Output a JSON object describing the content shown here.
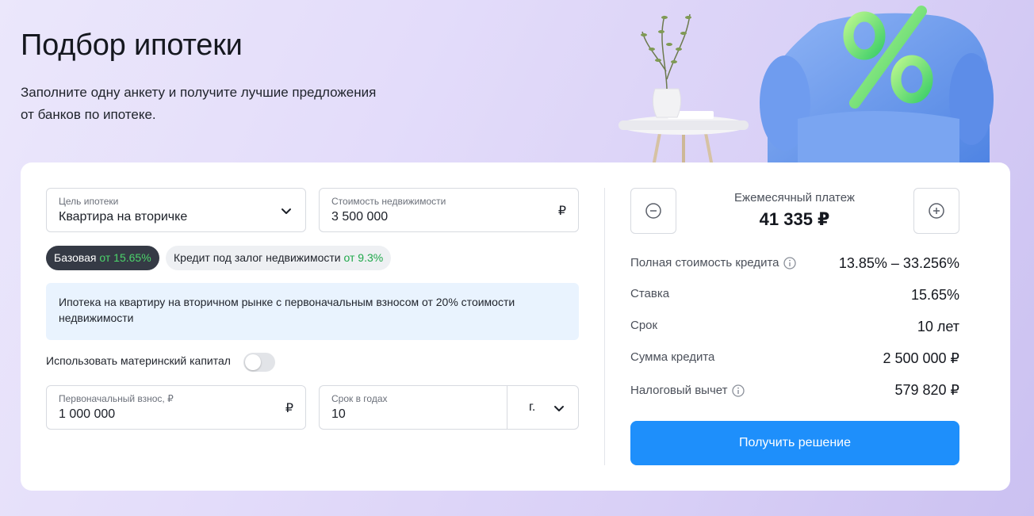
{
  "header": {
    "title": "Подбор ипотеки",
    "subtitle_line1": "Заполните одну анкету и получите лучшие предложения",
    "subtitle_line2": "от банков по ипотеке."
  },
  "form": {
    "purpose": {
      "label": "Цель ипотеки",
      "value": "Квартира на вторичке"
    },
    "price": {
      "label": "Стоимость недвижимости",
      "value": "3 500 000",
      "currency": "₽"
    },
    "programs": [
      {
        "label": "Базовая",
        "rate": "от 15.65%",
        "active": true
      },
      {
        "label": "Кредит под залог недвижимости",
        "rate": "от 9.3%",
        "active": false
      }
    ],
    "description": "Ипотека на квартиру на вторичном рынке с первоначальным взносом от 20% стоимости недвижимости",
    "maternity_capital": {
      "label": "Использовать материнский капитал",
      "enabled": false
    },
    "down_payment": {
      "label": "Первоначальный взнос, ₽",
      "value": "1 000 000",
      "currency": "₽"
    },
    "term": {
      "label": "Срок в годах",
      "value": "10",
      "unit": "г."
    }
  },
  "summary": {
    "monthly_label": "Ежемесячный платеж",
    "monthly_value": "41 335 ₽",
    "rows": [
      {
        "label": "Полная стоимость кредита",
        "value": "13.85% – 33.256%",
        "info": true
      },
      {
        "label": "Ставка",
        "value": "15.65%",
        "info": false
      },
      {
        "label": "Срок",
        "value": "10 лет",
        "info": false
      },
      {
        "label": "Сумма кредита",
        "value": "2 500 000 ₽",
        "info": false
      },
      {
        "label": "Налоговый вычет",
        "value": "579 820 ₽",
        "info": true
      }
    ],
    "cta_label": "Получить решение"
  },
  "colors": {
    "accent": "#1e8ffb",
    "chip_active": "#353a45",
    "rate_green": "#1fa84a",
    "info_bg": "#e9f3fe"
  }
}
